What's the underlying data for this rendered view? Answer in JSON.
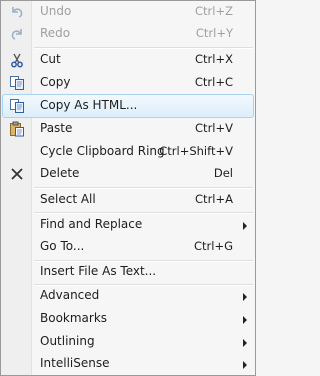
{
  "menu": {
    "undo": {
      "label": "Undo",
      "shortcut": "Ctrl+Z"
    },
    "redo": {
      "label": "Redo",
      "shortcut": "Ctrl+Y"
    },
    "cut": {
      "label": "Cut",
      "shortcut": "Ctrl+X"
    },
    "copy": {
      "label": "Copy",
      "shortcut": "Ctrl+C"
    },
    "copy_html": {
      "label": "Copy As HTML..."
    },
    "paste": {
      "label": "Paste",
      "shortcut": "Ctrl+V"
    },
    "cycle": {
      "label": "Cycle Clipboard Ring",
      "shortcut": "Ctrl+Shift+V"
    },
    "delete": {
      "label": "Delete",
      "shortcut": "Del"
    },
    "select_all": {
      "label": "Select All",
      "shortcut": "Ctrl+A"
    },
    "find_replace": {
      "label": "Find and Replace"
    },
    "goto": {
      "label": "Go To...",
      "shortcut": "Ctrl+G"
    },
    "insert_file": {
      "label": "Insert File As Text..."
    },
    "advanced": {
      "label": "Advanced"
    },
    "bookmarks": {
      "label": "Bookmarks"
    },
    "outlining": {
      "label": "Outlining"
    },
    "intellisense": {
      "label": "IntelliSense"
    }
  },
  "colors": {
    "highlight_border": "#a9d4f0",
    "disabled_text": "#a0a0a0"
  }
}
